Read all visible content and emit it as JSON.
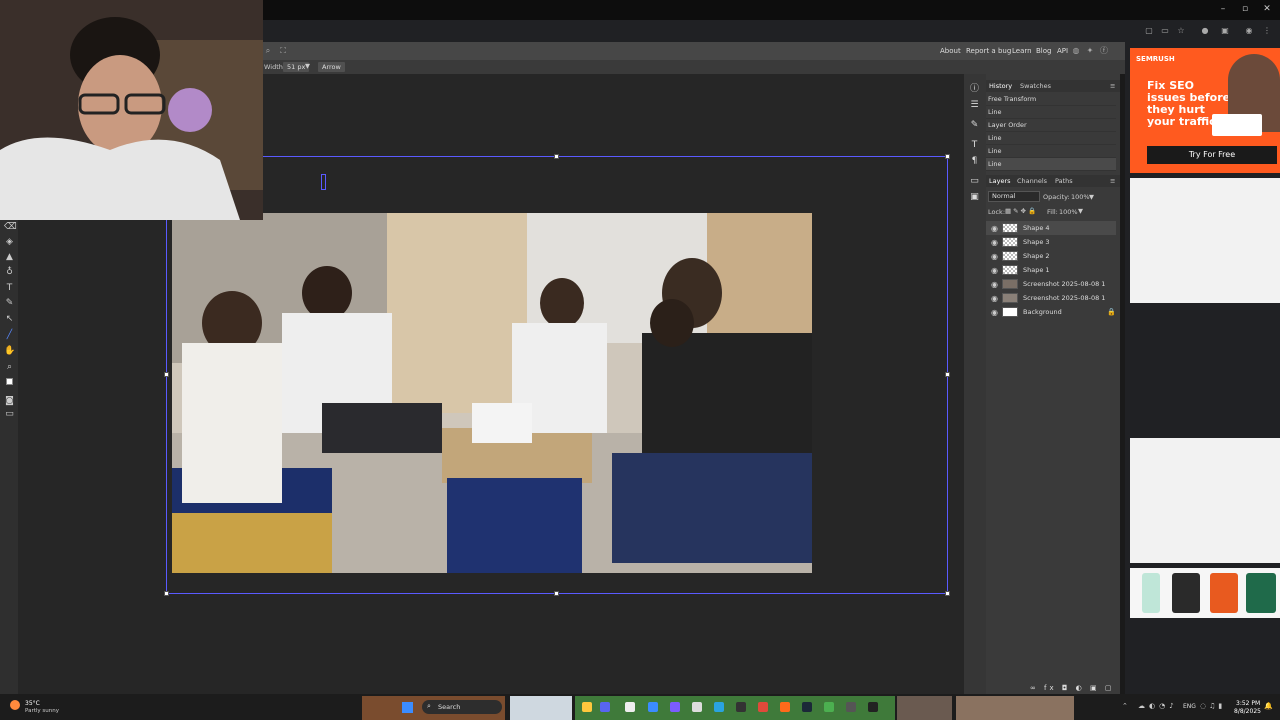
{
  "menu": {
    "about": "About",
    "report_bug": "Report a bug",
    "learn": "Learn",
    "blog": "Blog",
    "api": "API"
  },
  "options": {
    "width_label": "Width:",
    "width_value": "51 px",
    "arrow_btn": "Arrow"
  },
  "history": {
    "tabs": [
      "History",
      "Swatches"
    ],
    "items": [
      "Free Transform",
      "Line",
      "Layer Order",
      "Line",
      "Line",
      "Line"
    ]
  },
  "layers": {
    "tabs": [
      "Layers",
      "Channels",
      "Paths"
    ],
    "blend_mode": "Normal",
    "opacity_label": "Opacity:",
    "opacity_value": "100%",
    "lock_label": "Lock:",
    "fill_label": "Fill:",
    "fill_value": "100%",
    "items": [
      "Shape 4",
      "Shape 3",
      "Shape 2",
      "Shape 1",
      "Screenshot 2025-08-08 1",
      "Screenshot 2025-08-08 1",
      "Background"
    ]
  },
  "ad": {
    "brand": "SEMRUSH",
    "headline_1": "Fix SEO",
    "headline_2": "issues before",
    "headline_3": "they hurt",
    "headline_4": "your traffic",
    "cta": "Try For Free"
  },
  "taskbar": {
    "weather_temp": "35°C",
    "weather_desc": "Partly sunny",
    "search": "Search",
    "lang": "ENG",
    "time": "3:52 PM",
    "date": "8/8/2025"
  },
  "colors": {
    "accent": "#5a5aff",
    "semrush": "#ff5a1f",
    "panel": "#3a3a3a"
  }
}
